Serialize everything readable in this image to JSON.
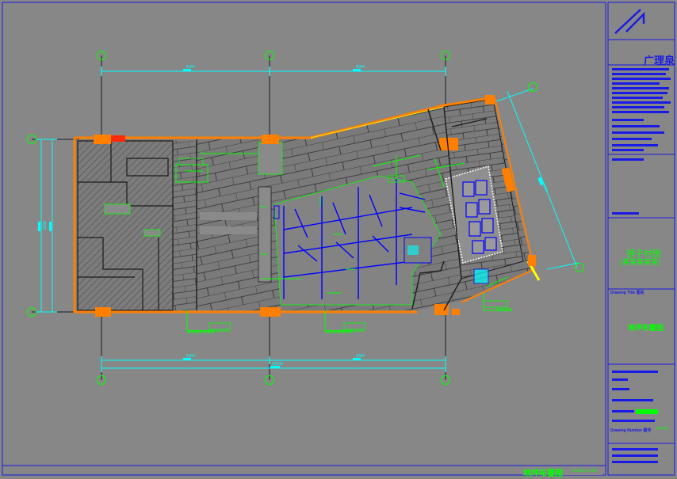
{
  "title_block": {
    "company_logo": "广理泉",
    "project_name": "银子村图",
    "project_subtitle": "(某某某某某)",
    "label_drawing_title": "Drawing Title 图名",
    "drawing_title": "地坪布置图",
    "label_drawing_number": "Drawing Number 图号",
    "drawing_number": "PF-00"
  },
  "footer": {
    "title": "地坪布置图",
    "scale": "SCALE 1:100"
  },
  "dimensions": {
    "top": [
      "6000",
      "6000"
    ],
    "top_total": "",
    "bottom": [
      "6000",
      "6000"
    ],
    "bottom_total": "12000",
    "left": "6000",
    "diagonal": "6000"
  },
  "callouts": [
    "某某某某某某某",
    "某某某某某某某",
    "某某某某"
  ],
  "axis_marks": [
    "",
    "",
    "",
    "",
    "",
    "",
    "",
    "",
    "",
    ""
  ],
  "colors": {
    "background": "#878787",
    "frame": "#1a1ae6",
    "wall": "#ff7f00",
    "dimension": "#00ffff",
    "axis_circle": "#00ff00",
    "annotation": "#00ff00",
    "fixture": "#0000ff",
    "hatch": "#5a5a5a",
    "tile_line": "#2b2b2b"
  }
}
